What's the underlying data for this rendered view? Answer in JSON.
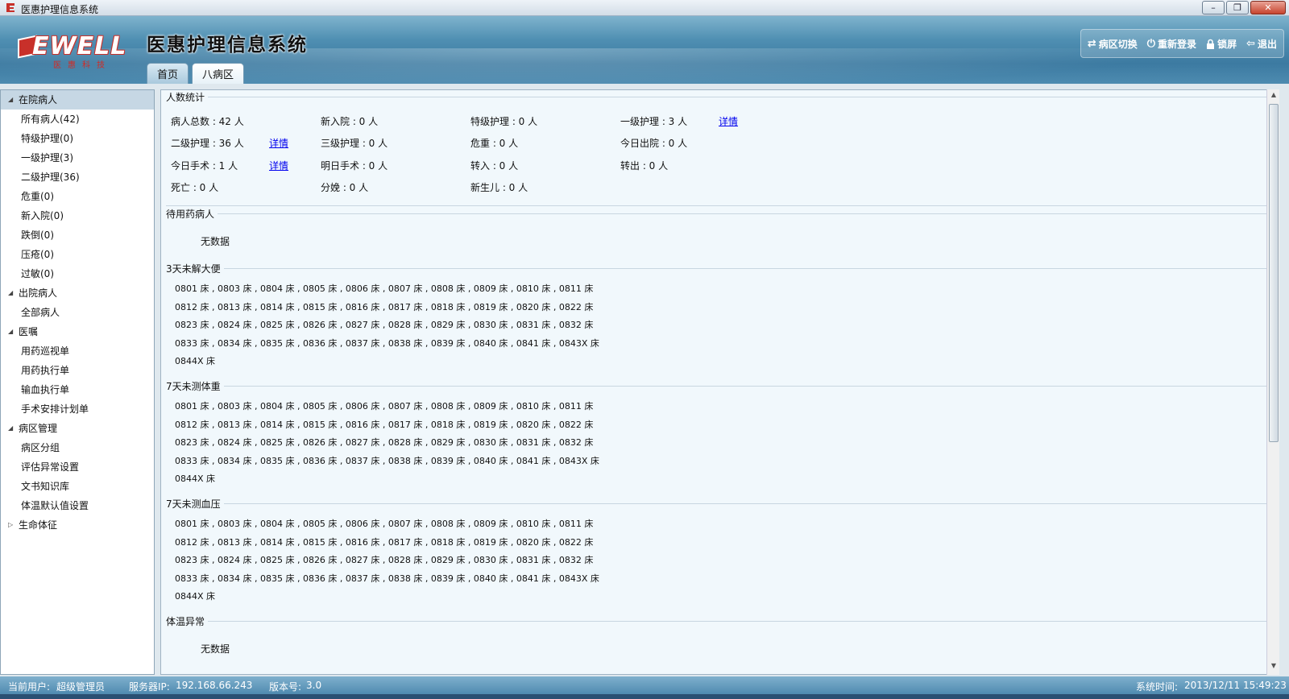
{
  "window": {
    "title": "医惠护理信息系统"
  },
  "header": {
    "logo_text": "EWELL",
    "logo_sub": "医惠科技",
    "app_title": "医惠护理信息系统",
    "tabs": [
      {
        "label": "首页"
      },
      {
        "label": "八病区"
      }
    ],
    "tools": [
      {
        "label": "病区切换",
        "icon": "switch-icon"
      },
      {
        "label": "重新登录",
        "icon": "power-icon"
      },
      {
        "label": "锁屏",
        "icon": "lock-icon"
      },
      {
        "label": "退出",
        "icon": "exit-icon"
      }
    ]
  },
  "sidebar": {
    "items": [
      {
        "label": "在院病人",
        "type": "group",
        "expanded": true,
        "selected": true
      },
      {
        "label": "所有病人(42)",
        "type": "child"
      },
      {
        "label": "特级护理(0)",
        "type": "child"
      },
      {
        "label": "一级护理(3)",
        "type": "child"
      },
      {
        "label": "二级护理(36)",
        "type": "child"
      },
      {
        "label": "危重(0)",
        "type": "child"
      },
      {
        "label": "新入院(0)",
        "type": "child"
      },
      {
        "label": "跌倒(0)",
        "type": "child"
      },
      {
        "label": "压疮(0)",
        "type": "child"
      },
      {
        "label": "过敏(0)",
        "type": "child"
      },
      {
        "label": "出院病人",
        "type": "group",
        "expanded": true
      },
      {
        "label": "全部病人",
        "type": "child"
      },
      {
        "label": "医嘱",
        "type": "group",
        "expanded": true
      },
      {
        "label": "用药巡视单",
        "type": "child"
      },
      {
        "label": "用药执行单",
        "type": "child"
      },
      {
        "label": "输血执行单",
        "type": "child"
      },
      {
        "label": "手术安排计划单",
        "type": "child"
      },
      {
        "label": "病区管理",
        "type": "group",
        "expanded": true
      },
      {
        "label": "病区分组",
        "type": "child"
      },
      {
        "label": "评估异常设置",
        "type": "child"
      },
      {
        "label": "文书知识库",
        "type": "child"
      },
      {
        "label": "体温默认值设置",
        "type": "child"
      },
      {
        "label": "生命体征",
        "type": "group",
        "expanded": false
      }
    ]
  },
  "stats": {
    "legend": "人数统计",
    "detail_label": "详情",
    "rows": [
      [
        {
          "text": "病人总数 : 42 人"
        },
        {
          "text": "新入院 : 0 人"
        },
        {
          "text": "特级护理 : 0 人"
        },
        {
          "text": "一级护理 : 3 人",
          "detail": true
        }
      ],
      [
        {
          "text": "二级护理 : 36 人",
          "detail": true
        },
        {
          "text": "三级护理 : 0 人"
        },
        {
          "text": "危重 : 0 人"
        },
        {
          "text": "今日出院 : 0 人"
        }
      ],
      [
        {
          "text": "今日手术 : 1 人",
          "detail": true
        },
        {
          "text": "明日手术 : 0 人"
        },
        {
          "text": "转入 : 0 人"
        },
        {
          "text": "转出 : 0 人"
        }
      ],
      [
        {
          "text": "死亡 : 0 人"
        },
        {
          "text": "分娩 : 0 人"
        },
        {
          "text": "新生儿 : 0 人"
        }
      ]
    ]
  },
  "sections": [
    {
      "legend": "待用药病人",
      "no_data": "无数据"
    },
    {
      "legend": "3天未解大便",
      "lines": [
        "0801 床 , 0803 床 , 0804 床 , 0805 床 , 0806 床 , 0807 床 , 0808 床 , 0809 床 , 0810 床 , 0811 床",
        "0812 床 , 0813 床 , 0814 床 , 0815 床 , 0816 床 , 0817 床 , 0818 床 , 0819 床 , 0820 床 , 0822 床",
        "0823 床 , 0824 床 , 0825 床 , 0826 床 , 0827 床 , 0828 床 , 0829 床 , 0830 床 , 0831 床 , 0832 床",
        "0833 床 , 0834 床 , 0835 床 , 0836 床 , 0837 床 , 0838 床 , 0839 床 , 0840 床 , 0841 床 , 0843X 床",
        "0844X 床"
      ]
    },
    {
      "legend": "7天未测体重",
      "lines": [
        "0801 床 , 0803 床 , 0804 床 , 0805 床 , 0806 床 , 0807 床 , 0808 床 , 0809 床 , 0810 床 , 0811 床",
        "0812 床 , 0813 床 , 0814 床 , 0815 床 , 0816 床 , 0817 床 , 0818 床 , 0819 床 , 0820 床 , 0822 床",
        "0823 床 , 0824 床 , 0825 床 , 0826 床 , 0827 床 , 0828 床 , 0829 床 , 0830 床 , 0831 床 , 0832 床",
        "0833 床 , 0834 床 , 0835 床 , 0836 床 , 0837 床 , 0838 床 , 0839 床 , 0840 床 , 0841 床 , 0843X 床",
        "0844X 床"
      ]
    },
    {
      "legend": "7天未测血压",
      "lines": [
        "0801 床 , 0803 床 , 0804 床 , 0805 床 , 0806 床 , 0807 床 , 0808 床 , 0809 床 , 0810 床 , 0811 床",
        "0812 床 , 0813 床 , 0814 床 , 0815 床 , 0816 床 , 0817 床 , 0818 床 , 0819 床 , 0820 床 , 0822 床",
        "0823 床 , 0824 床 , 0825 床 , 0826 床 , 0827 床 , 0828 床 , 0829 床 , 0830 床 , 0831 床 , 0832 床",
        "0833 床 , 0834 床 , 0835 床 , 0836 床 , 0837 床 , 0838 床 , 0839 床 , 0840 床 , 0841 床 , 0843X 床",
        "0844X 床"
      ]
    },
    {
      "legend": "体温异常",
      "no_data": "无数据"
    }
  ],
  "statusbar": {
    "user_label": "当前用户:",
    "user": "超级管理员",
    "server_label": "服务器IP:",
    "server": "192.168.66.243",
    "version_label": "版本号:",
    "version": "3.0",
    "time_label": "系统时间:",
    "time": "2013/12/11 15:49:23"
  },
  "colors": {
    "header": "#3c7aa1",
    "link": "#0000ee",
    "panel": "#f1f8fc"
  }
}
